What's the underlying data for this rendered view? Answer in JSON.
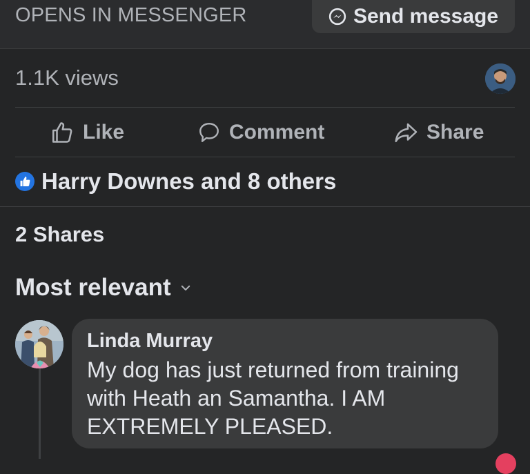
{
  "messenger": {
    "opens_label": "OPENS IN MESSENGER",
    "send_label": "Send message"
  },
  "stats": {
    "views": "1.1K views"
  },
  "actions": {
    "like": "Like",
    "comment": "Comment",
    "share": "Share"
  },
  "reactions": {
    "summary": "Harry Downes and 8 others"
  },
  "shares": {
    "label": "2 Shares"
  },
  "sort": {
    "label": "Most relevant"
  },
  "comments": [
    {
      "author": "Linda Murray",
      "text": "My dog has just returned from training with Heath an Samantha.  I AM EXTREMELY PLEASED."
    }
  ],
  "colors": {
    "background": "#242526",
    "surface": "#3a3b3c",
    "text_primary": "#e4e6eb",
    "text_secondary": "#b0b3b8",
    "like_blue": "#2374e1"
  },
  "icons": [
    "messenger-icon",
    "thumbs-up-icon",
    "comment-icon",
    "share-icon",
    "like-reaction-icon",
    "chevron-down-icon"
  ]
}
